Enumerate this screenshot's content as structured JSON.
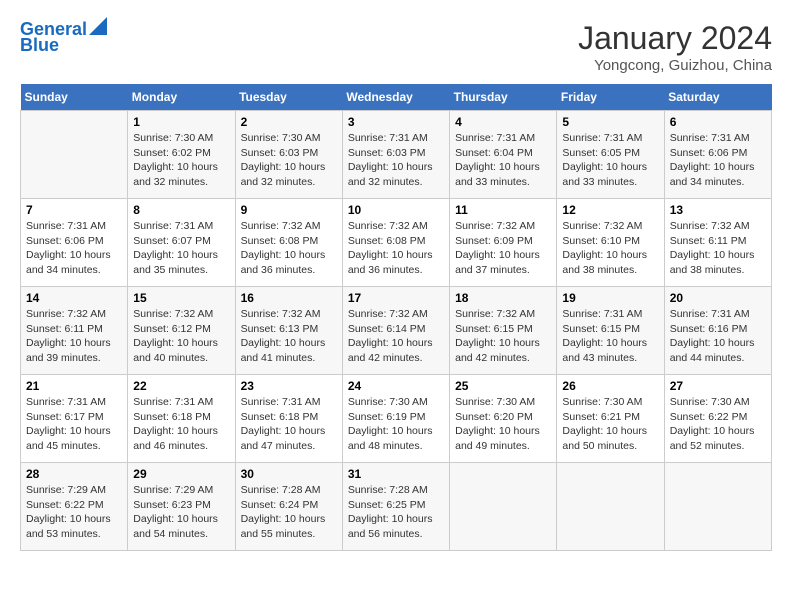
{
  "header": {
    "logo_line1": "General",
    "logo_line2": "Blue",
    "month_year": "January 2024",
    "location": "Yongcong, Guizhou, China"
  },
  "weekdays": [
    "Sunday",
    "Monday",
    "Tuesday",
    "Wednesday",
    "Thursday",
    "Friday",
    "Saturday"
  ],
  "weeks": [
    [
      {
        "day": "",
        "sunrise": "",
        "sunset": "",
        "daylight": ""
      },
      {
        "day": "1",
        "sunrise": "Sunrise: 7:30 AM",
        "sunset": "Sunset: 6:02 PM",
        "daylight": "Daylight: 10 hours and 32 minutes."
      },
      {
        "day": "2",
        "sunrise": "Sunrise: 7:30 AM",
        "sunset": "Sunset: 6:03 PM",
        "daylight": "Daylight: 10 hours and 32 minutes."
      },
      {
        "day": "3",
        "sunrise": "Sunrise: 7:31 AM",
        "sunset": "Sunset: 6:03 PM",
        "daylight": "Daylight: 10 hours and 32 minutes."
      },
      {
        "day": "4",
        "sunrise": "Sunrise: 7:31 AM",
        "sunset": "Sunset: 6:04 PM",
        "daylight": "Daylight: 10 hours and 33 minutes."
      },
      {
        "day": "5",
        "sunrise": "Sunrise: 7:31 AM",
        "sunset": "Sunset: 6:05 PM",
        "daylight": "Daylight: 10 hours and 33 minutes."
      },
      {
        "day": "6",
        "sunrise": "Sunrise: 7:31 AM",
        "sunset": "Sunset: 6:06 PM",
        "daylight": "Daylight: 10 hours and 34 minutes."
      }
    ],
    [
      {
        "day": "7",
        "sunrise": "Sunrise: 7:31 AM",
        "sunset": "Sunset: 6:06 PM",
        "daylight": "Daylight: 10 hours and 34 minutes."
      },
      {
        "day": "8",
        "sunrise": "Sunrise: 7:31 AM",
        "sunset": "Sunset: 6:07 PM",
        "daylight": "Daylight: 10 hours and 35 minutes."
      },
      {
        "day": "9",
        "sunrise": "Sunrise: 7:32 AM",
        "sunset": "Sunset: 6:08 PM",
        "daylight": "Daylight: 10 hours and 36 minutes."
      },
      {
        "day": "10",
        "sunrise": "Sunrise: 7:32 AM",
        "sunset": "Sunset: 6:08 PM",
        "daylight": "Daylight: 10 hours and 36 minutes."
      },
      {
        "day": "11",
        "sunrise": "Sunrise: 7:32 AM",
        "sunset": "Sunset: 6:09 PM",
        "daylight": "Daylight: 10 hours and 37 minutes."
      },
      {
        "day": "12",
        "sunrise": "Sunrise: 7:32 AM",
        "sunset": "Sunset: 6:10 PM",
        "daylight": "Daylight: 10 hours and 38 minutes."
      },
      {
        "day": "13",
        "sunrise": "Sunrise: 7:32 AM",
        "sunset": "Sunset: 6:11 PM",
        "daylight": "Daylight: 10 hours and 38 minutes."
      }
    ],
    [
      {
        "day": "14",
        "sunrise": "Sunrise: 7:32 AM",
        "sunset": "Sunset: 6:11 PM",
        "daylight": "Daylight: 10 hours and 39 minutes."
      },
      {
        "day": "15",
        "sunrise": "Sunrise: 7:32 AM",
        "sunset": "Sunset: 6:12 PM",
        "daylight": "Daylight: 10 hours and 40 minutes."
      },
      {
        "day": "16",
        "sunrise": "Sunrise: 7:32 AM",
        "sunset": "Sunset: 6:13 PM",
        "daylight": "Daylight: 10 hours and 41 minutes."
      },
      {
        "day": "17",
        "sunrise": "Sunrise: 7:32 AM",
        "sunset": "Sunset: 6:14 PM",
        "daylight": "Daylight: 10 hours and 42 minutes."
      },
      {
        "day": "18",
        "sunrise": "Sunrise: 7:32 AM",
        "sunset": "Sunset: 6:15 PM",
        "daylight": "Daylight: 10 hours and 42 minutes."
      },
      {
        "day": "19",
        "sunrise": "Sunrise: 7:31 AM",
        "sunset": "Sunset: 6:15 PM",
        "daylight": "Daylight: 10 hours and 43 minutes."
      },
      {
        "day": "20",
        "sunrise": "Sunrise: 7:31 AM",
        "sunset": "Sunset: 6:16 PM",
        "daylight": "Daylight: 10 hours and 44 minutes."
      }
    ],
    [
      {
        "day": "21",
        "sunrise": "Sunrise: 7:31 AM",
        "sunset": "Sunset: 6:17 PM",
        "daylight": "Daylight: 10 hours and 45 minutes."
      },
      {
        "day": "22",
        "sunrise": "Sunrise: 7:31 AM",
        "sunset": "Sunset: 6:18 PM",
        "daylight": "Daylight: 10 hours and 46 minutes."
      },
      {
        "day": "23",
        "sunrise": "Sunrise: 7:31 AM",
        "sunset": "Sunset: 6:18 PM",
        "daylight": "Daylight: 10 hours and 47 minutes."
      },
      {
        "day": "24",
        "sunrise": "Sunrise: 7:30 AM",
        "sunset": "Sunset: 6:19 PM",
        "daylight": "Daylight: 10 hours and 48 minutes."
      },
      {
        "day": "25",
        "sunrise": "Sunrise: 7:30 AM",
        "sunset": "Sunset: 6:20 PM",
        "daylight": "Daylight: 10 hours and 49 minutes."
      },
      {
        "day": "26",
        "sunrise": "Sunrise: 7:30 AM",
        "sunset": "Sunset: 6:21 PM",
        "daylight": "Daylight: 10 hours and 50 minutes."
      },
      {
        "day": "27",
        "sunrise": "Sunrise: 7:30 AM",
        "sunset": "Sunset: 6:22 PM",
        "daylight": "Daylight: 10 hours and 52 minutes."
      }
    ],
    [
      {
        "day": "28",
        "sunrise": "Sunrise: 7:29 AM",
        "sunset": "Sunset: 6:22 PM",
        "daylight": "Daylight: 10 hours and 53 minutes."
      },
      {
        "day": "29",
        "sunrise": "Sunrise: 7:29 AM",
        "sunset": "Sunset: 6:23 PM",
        "daylight": "Daylight: 10 hours and 54 minutes."
      },
      {
        "day": "30",
        "sunrise": "Sunrise: 7:28 AM",
        "sunset": "Sunset: 6:24 PM",
        "daylight": "Daylight: 10 hours and 55 minutes."
      },
      {
        "day": "31",
        "sunrise": "Sunrise: 7:28 AM",
        "sunset": "Sunset: 6:25 PM",
        "daylight": "Daylight: 10 hours and 56 minutes."
      },
      {
        "day": "",
        "sunrise": "",
        "sunset": "",
        "daylight": ""
      },
      {
        "day": "",
        "sunrise": "",
        "sunset": "",
        "daylight": ""
      },
      {
        "day": "",
        "sunrise": "",
        "sunset": "",
        "daylight": ""
      }
    ]
  ]
}
